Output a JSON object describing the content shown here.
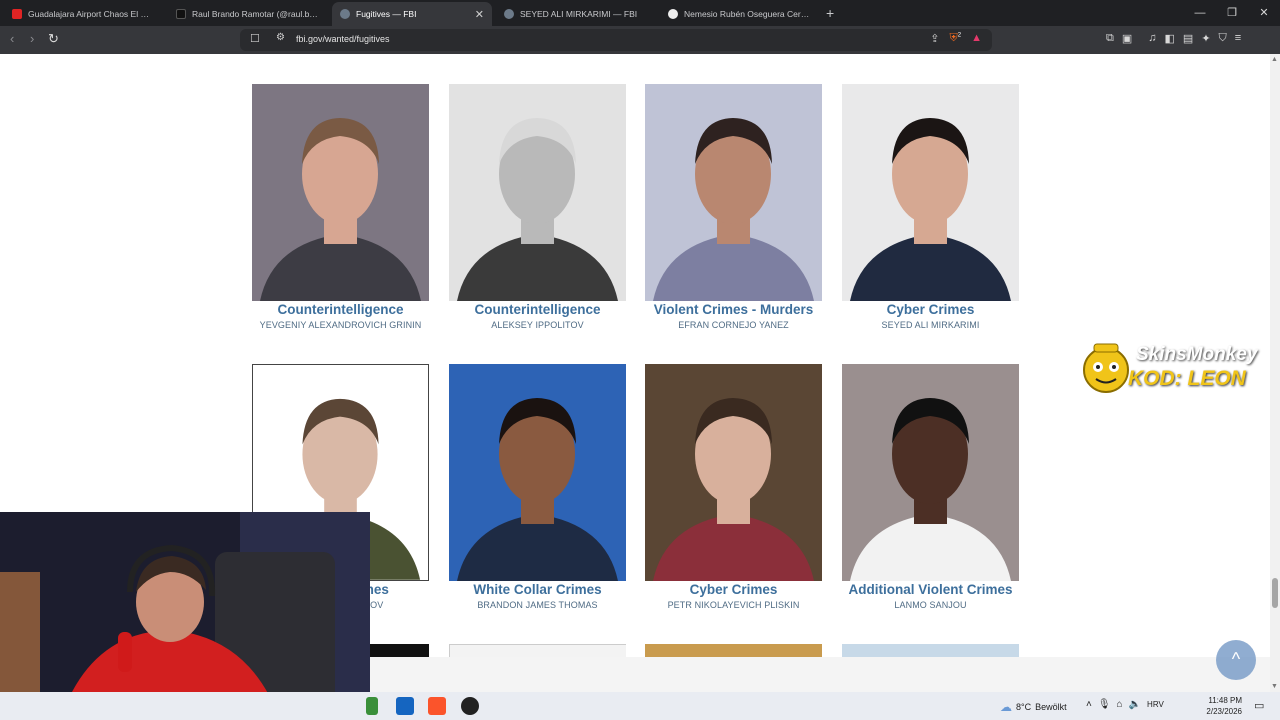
{
  "browser": {
    "tabs": [
      {
        "title": "Guadalajara Airport Chaos El Mencho",
        "favicon_color": "#e02424",
        "active": false
      },
      {
        "title": "Raul Brando Ramotar (@raul.brando",
        "favicon_color": "#111111",
        "active": false
      },
      {
        "title": "Fugitives — FBI",
        "favicon_color": "#6c7a89",
        "active": true
      },
      {
        "title": "SEYED ALI MIRKARIMI — FBI",
        "favicon_color": "#6c7a89",
        "active": false
      },
      {
        "title": "Nemesio Rubén Oseguera Cervantes",
        "favicon_color": "#eeeeee",
        "active": false
      }
    ],
    "url": "fbi.gov/wanted/fugitives",
    "shield_badge": "2"
  },
  "fugitives": [
    {
      "category": "Counterintelligence",
      "name": "YEVGENIY ALEXANDROVICH GRININ",
      "bg": "#7d7682",
      "shirt": "#3d3c44",
      "skin": "#d7a692",
      "hair": "#7a5a44"
    },
    {
      "category": "Counterintelligence",
      "name": "ALEKSEY IPPOLITOV",
      "bg": "#e2e2e2",
      "shirt": "#3a3a3a",
      "skin": "#b9b9b9",
      "hair": "#d8d8d8"
    },
    {
      "category": "Violent Crimes - Murders",
      "name": "EFRAN CORNEJO YANEZ",
      "bg": "#bfc3d6",
      "shirt": "#7d7fa1",
      "skin": "#b98770",
      "hair": "#2e2220"
    },
    {
      "category": "Cyber Crimes",
      "name": "SEYED ALI MIRKARIMI",
      "bg": "#e9e9ea",
      "shirt": "#202a40",
      "skin": "#d6a892",
      "hair": "#1b1514"
    },
    {
      "category": "Military Crimes",
      "name": "DMITRIY DETISTOV",
      "bg": "#ffffff",
      "shirt": "#4a5232",
      "skin": "#d9b8a6",
      "hair": "#5b4636"
    },
    {
      "category": "White Collar Crimes",
      "name": "BRANDON JAMES THOMAS",
      "bg": "#2d63b5",
      "shirt": "#1e2b44",
      "skin": "#8a5a40",
      "hair": "#1a1210"
    },
    {
      "category": "Cyber Crimes",
      "name": "PETR NIKOLAYEVICH PLISKIN",
      "bg": "#5a4634",
      "shirt": "#8b2f3a",
      "skin": "#d8b09c",
      "hair": "#3a2a20"
    },
    {
      "category": "Additional Violent Crimes",
      "name": "LANMO SANJOU",
      "bg": "#9a8f8f",
      "shirt": "#f2f2f2",
      "skin": "#4c2f25",
      "hair": "#111111"
    }
  ],
  "partial_row_colors": [
    "#111111",
    "#f3f3f3",
    "#c99b4e",
    "#c7d9e8"
  ],
  "overlay": {
    "promo_line1": "SkinsMonkey",
    "promo_line2": "KOD: LEON",
    "back_to_top": "^"
  },
  "taskbar": {
    "temperature": "8°C",
    "weather_text": "Bewölkt",
    "language": "HRV",
    "time": "11:48 PM",
    "date": "2/23/2026"
  }
}
